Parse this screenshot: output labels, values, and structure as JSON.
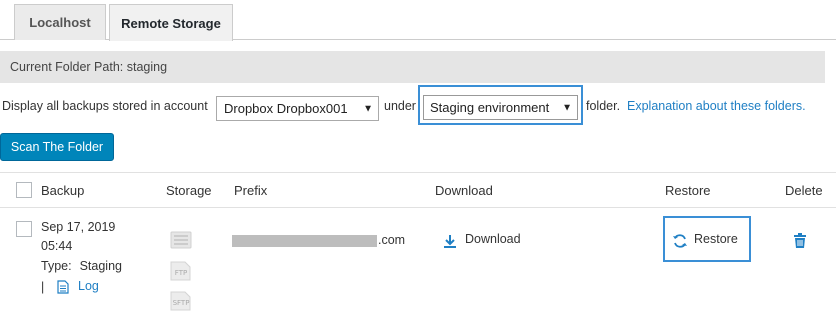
{
  "tabs": [
    {
      "label": "Localhost"
    },
    {
      "label": "Remote Storage"
    }
  ],
  "current_path": "Current Folder Path: staging",
  "account_row": {
    "lead_text": "Display all backups stored in account",
    "account_select": "Dropbox Dropbox001",
    "under_text": "under",
    "env_select": "Staging environment",
    "folder_text": "folder.",
    "explanation_link": "Explanation about these folders."
  },
  "scan_button": "Scan The Folder",
  "table": {
    "headers": {
      "backup": "Backup",
      "storage": "Storage",
      "prefix": "Prefix",
      "download": "Download",
      "restore": "Restore",
      "delete": "Delete"
    },
    "rows": [
      {
        "date": "Sep 17, 2019",
        "time": "05:44",
        "type_label": "Type:",
        "type_value": "Staging",
        "log_sep": "|",
        "log_label": "Log",
        "storage_icons": [
          "dropbox-icon",
          "ftp-icon",
          "sftp-icon"
        ],
        "storage_labels": {
          "ftp": "FTP",
          "sftp": "SFTP"
        },
        "prefix_suffix": ".com",
        "download_label": "Download",
        "restore_label": "Restore"
      }
    ]
  },
  "colors": {
    "primary_button": "#0085ba",
    "link": "#1f7fc4",
    "highlight_box": "#3a8fd6",
    "path_bar": "#e5e5e5"
  }
}
